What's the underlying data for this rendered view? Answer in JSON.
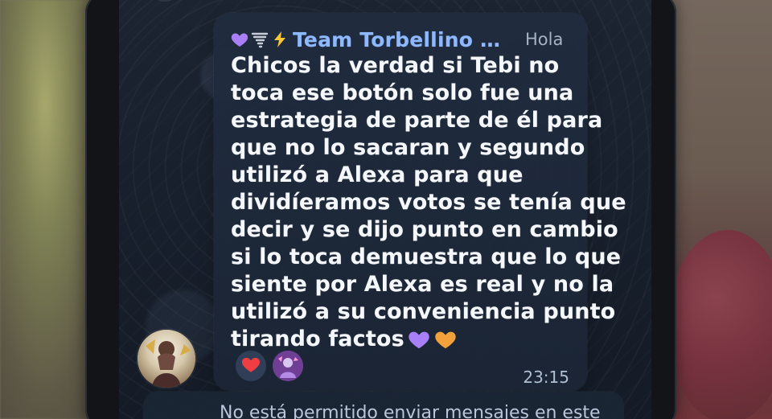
{
  "header": {
    "sender_name": "Team Torbellino Morad...",
    "quoted_label": "Hola",
    "icons": [
      "purple-heart-icon",
      "tornado-icon",
      "lightning-icon"
    ]
  },
  "message": {
    "lines": [
      "Chicos la verdad si Tebi no",
      "toca ese botón solo fue una",
      "estrategia de parte de él para",
      "que no lo sacaran y segundo",
      "utilizó a Alexa para que",
      "dividíeramos votos se tenía que",
      "decir y se dijo punto en cambio",
      "si lo toca demuestra que lo que",
      "siente por Alexa es real y no la",
      "utilizó a su conveniencia punto",
      "tirando factos"
    ],
    "trailing_emojis": [
      "purple-heart-icon",
      "orange-heart-icon"
    ]
  },
  "reactions": {
    "items": [
      "red-heart-icon",
      "reaction-avatar"
    ]
  },
  "meta": {
    "time": "23:15"
  },
  "footer": {
    "notice": "No está permitido enviar mensajes en este"
  },
  "colors": {
    "sender_name": "#8eb8ff",
    "message_text": "#f4f7fb",
    "bubble_bg": "#202c3f",
    "screen_bg": "#18202d"
  }
}
